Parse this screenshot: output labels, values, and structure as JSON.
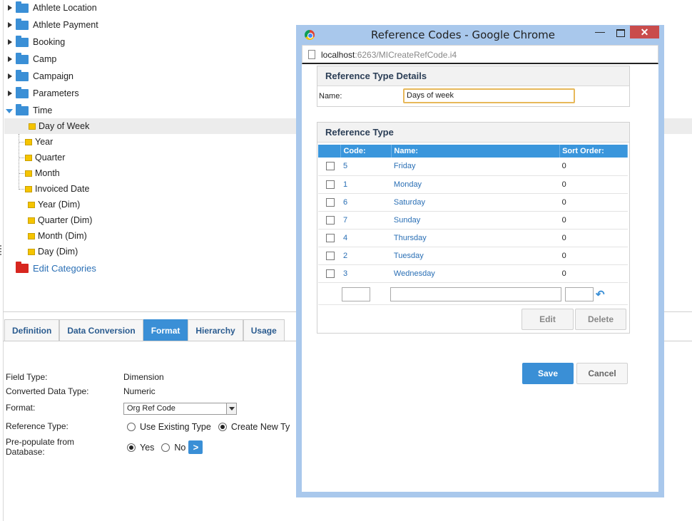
{
  "tree": {
    "top_items": [
      {
        "label": "Athlete Location"
      },
      {
        "label": "Athlete Payment"
      },
      {
        "label": "Booking"
      },
      {
        "label": "Camp"
      },
      {
        "label": "Campaign"
      },
      {
        "label": "Parameters"
      },
      {
        "label": "Time"
      }
    ],
    "time_children": [
      {
        "label": "Day of Week"
      },
      {
        "label": "Year"
      },
      {
        "label": "Quarter"
      },
      {
        "label": "Month"
      },
      {
        "label": "Invoiced Date"
      },
      {
        "label": "Year (Dim)"
      },
      {
        "label": "Quarter (Dim)"
      },
      {
        "label": "Month (Dim)"
      },
      {
        "label": "Day (Dim)"
      }
    ],
    "edit_categories": "Edit Categories"
  },
  "tabs": [
    {
      "label": "Definition"
    },
    {
      "label": "Data Conversion"
    },
    {
      "label": "Format"
    },
    {
      "label": "Hierarchy"
    },
    {
      "label": "Usage"
    }
  ],
  "form": {
    "field_type_label": "Field Type:",
    "field_type_value": "Dimension",
    "converted_label": "Converted Data Type:",
    "converted_value": "Numeric",
    "format_label": "Format:",
    "format_value": "Org Ref Code",
    "reference_type_label": "Reference Type:",
    "use_existing": "Use Existing Type",
    "create_new": "Create New Ty",
    "prepopulate_label_1": "Pre-populate from",
    "prepopulate_label_2": "Database:",
    "yes": "Yes",
    "no": "No",
    "go": ">"
  },
  "window": {
    "title": "Reference Codes - Google Chrome",
    "url_host": "localhost",
    "url_rest": ":6263/MICreateRefCode.i4",
    "minimize": "—",
    "close": "✕"
  },
  "details": {
    "heading": "Reference Type Details",
    "name_label": "Name:",
    "name_value": "Days of week"
  },
  "ref_type": {
    "heading": "Reference Type",
    "columns": {
      "code": "Code:",
      "name": "Name:",
      "sort": "Sort Order:"
    },
    "rows": [
      {
        "code": "5",
        "name": "Friday",
        "sort": "0"
      },
      {
        "code": "1",
        "name": "Monday",
        "sort": "0"
      },
      {
        "code": "6",
        "name": "Saturday",
        "sort": "0"
      },
      {
        "code": "7",
        "name": "Sunday",
        "sort": "0"
      },
      {
        "code": "4",
        "name": "Thursday",
        "sort": "0"
      },
      {
        "code": "2",
        "name": "Tuesday",
        "sort": "0"
      },
      {
        "code": "3",
        "name": "Wednesday",
        "sort": "0"
      }
    ],
    "edit": "Edit",
    "delete": "Delete"
  },
  "actions": {
    "save": "Save",
    "cancel": "Cancel"
  },
  "colors": {
    "accent": "#3a8fd6",
    "link": "#2a6fb5",
    "folder_blue": "#3a8fd6",
    "folder_yellow": "#f5c400",
    "folder_red": "#d7261f"
  }
}
